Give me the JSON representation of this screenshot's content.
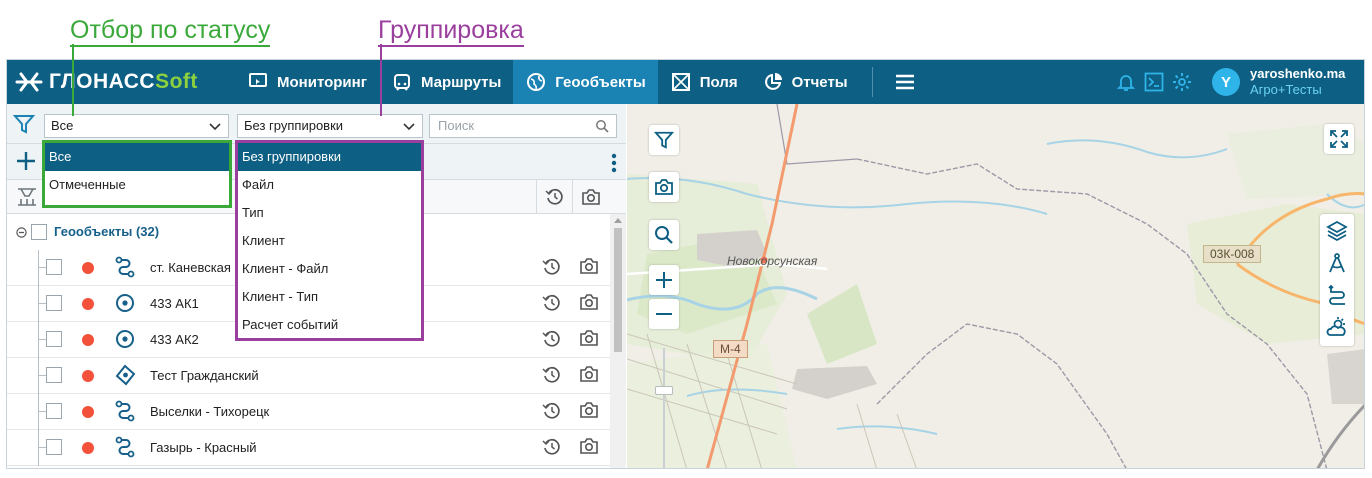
{
  "annotations": {
    "status_filter": "Отбор по статусу",
    "grouping": "Группировка"
  },
  "app": {
    "logo_main": "ГЛОНАСС",
    "logo_soft": "Soft",
    "nav": [
      {
        "label": "Мониторинг",
        "icon": "monitoring-icon",
        "active": false
      },
      {
        "label": "Маршруты",
        "icon": "routes-icon",
        "active": false
      },
      {
        "label": "Геообъекты",
        "icon": "globe-icon",
        "active": true
      },
      {
        "label": "Поля",
        "icon": "fields-icon",
        "active": false
      },
      {
        "label": "Отчеты",
        "icon": "reports-icon",
        "active": false
      }
    ],
    "user": {
      "initial": "Y",
      "name": "yaroshenko.ma",
      "org": "Агро+Тесты"
    },
    "colors": {
      "topbar": "#0d5f83",
      "active_tab": "#1b82b4",
      "accent_green": "#8dd13e",
      "status_dot": "#f4513a",
      "annotation_green": "#3aa93a",
      "annotation_purple": "#9b3f9e"
    }
  },
  "filters": {
    "status_value": "Все",
    "group_value": "Без группировки",
    "search_placeholder": "Поиск",
    "status_options": [
      "Все",
      "Отмеченные"
    ],
    "group_options": [
      "Без группировки",
      "Файл",
      "Тип",
      "Клиент",
      "Клиент - Файл",
      "Клиент - Тип",
      "Расчет событий"
    ]
  },
  "tree": {
    "root_label": "Геообъекты (32)",
    "rows": [
      {
        "label": "ст. Каневская",
        "icon": "route-icon"
      },
      {
        "label": "433 АК1",
        "icon": "point-icon"
      },
      {
        "label": "433 АК2",
        "icon": "point-icon"
      },
      {
        "label": "Тест Гражданский",
        "icon": "polygon-icon"
      },
      {
        "label": "Выселки - Тихорецк",
        "icon": "route-icon"
      },
      {
        "label": "Газырь - Красный",
        "icon": "route-icon"
      }
    ]
  },
  "map": {
    "place_label": "Новокорсунская",
    "road_labels": [
      "М-4",
      "03К-008"
    ]
  }
}
